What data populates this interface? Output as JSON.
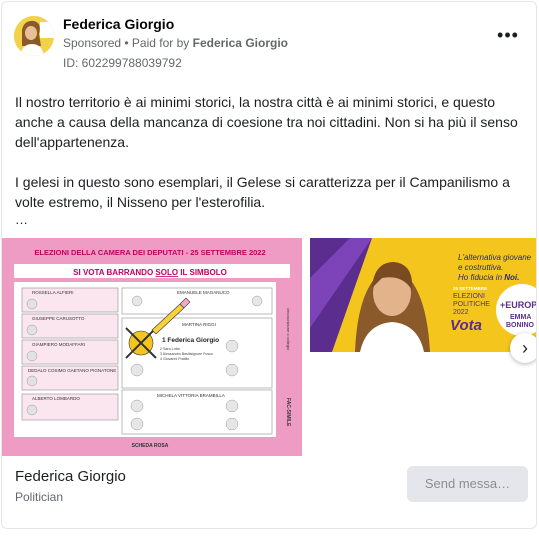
{
  "post": {
    "page_name": "Federica Giorgio",
    "sponsored": "Sponsored",
    "paid_prefix": " • Paid for by ",
    "paid_by": "Federica Giorgio",
    "id_line": "ID: 602299788039792",
    "more_glyph": "•••"
  },
  "body": {
    "paragraph1": "Il nostro territorio è ai minimi storici, la nostra città è ai minimi storici, e questo anche a causa della mancanza di coesione tra noi cittadini. Non si ha più il senso dell'appartenenza.",
    "paragraph2": "I gelesi in questo sono esemplari, il Gelese si caratterizza per il Campanilismo a volte estremo, il Nisseno per l'esterofilia.",
    "ellipsis": "…"
  },
  "ballot": {
    "header": "ELEZIONI DELLA CAMERA DEI DEPUTATI - 25 SETTEMBRE 2022",
    "instruction_pre": "SI VOTA BARRANDO ",
    "instruction_solo": "SOLO",
    "instruction_post": " IL SIMBOLO",
    "left_names": [
      "ROSSELLA ALFIERI",
      "GIUSEPPE CARUSOTTO",
      "GIAMPIERO MODAFFARI",
      "DEDALO COSIMO GAETANO PIGNATONE",
      "ALBERTO LOMBARDO"
    ],
    "right_top_name": "EMANUELE MAGANUCO",
    "martina": "MARTINA RIGGI",
    "candidate": "1 Federica Giorgio",
    "sub_list": [
      "2  Sara Lotta",
      "3  Alessandro Basilisignore Fusco",
      "4  Giovanni Pratillo"
    ],
    "michela": "MICHELA VITTORIA BRAMBILLA",
    "footer": "SCHEDA ROSA",
    "side_label1": "circoscrizione o collegio",
    "side_label2": "FAC-SIMILE"
  },
  "promo": {
    "tagline1": "L'alternativa giovane",
    "tagline2": "e costruttiva.",
    "tagline3_pre": "Ho fiducia in ",
    "tagline3_noi": "Noi.",
    "date": "25 SETTEMBRE",
    "elezioni": "ELEZIONI",
    "politiche": "POLITICHE",
    "year": "2022",
    "vota": "Vota",
    "logo_europa": "+EUROPA",
    "logo_emma": "EMMA",
    "logo_bonino": "BONINO"
  },
  "carousel": {
    "next_glyph": "›"
  },
  "footer": {
    "name": "Federica Giorgio",
    "subtitle": "Politician",
    "send_button": "Send messa…"
  },
  "colors": {
    "ballot_pink": "#ef9cc4",
    "ballot_header": "#e1006f",
    "promo_yellow": "#f4c61d",
    "promo_purple": "#5b2d8e",
    "button_grey": "#e4e6eb"
  }
}
